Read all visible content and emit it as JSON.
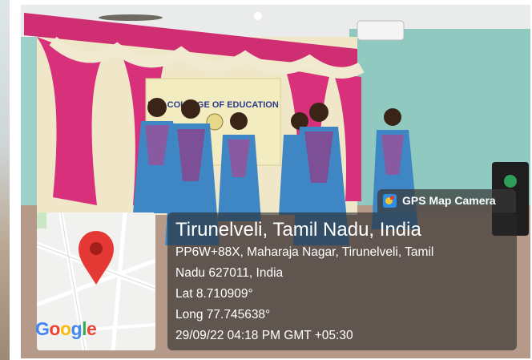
{
  "banner": {
    "text_partial": "LIGI COLLEGE OF EDUCATION"
  },
  "badge": {
    "label": "GPS Map Camera",
    "icon": "map-camera-app-icon"
  },
  "location": {
    "title": "Tirunelveli, Tamil Nadu, India",
    "address_line1": "PP6W+88X, Maharaja Nagar, Tirunelveli, Tamil",
    "address_line2": "Nadu 627011, India",
    "latitude": "Lat 8.710909°",
    "longitude": "Long 77.745638°",
    "datetime": "29/09/22 04:18 PM GMT +05:30"
  },
  "map": {
    "brand_letters": [
      "G",
      "o",
      "o",
      "g",
      "l",
      "e"
    ],
    "brand_colors": [
      "#4285F4",
      "#EA4335",
      "#FBBC05",
      "#4285F4",
      "#34A853",
      "#EA4335"
    ],
    "pin_color": "#E53935",
    "icon": "map-pin-icon"
  },
  "colors": {
    "curtain_pink": "#d8307a",
    "curtain_cream": "#f1ead0",
    "wall_teal": "#8fc9bf",
    "saree_blue": "#3f87c4"
  }
}
